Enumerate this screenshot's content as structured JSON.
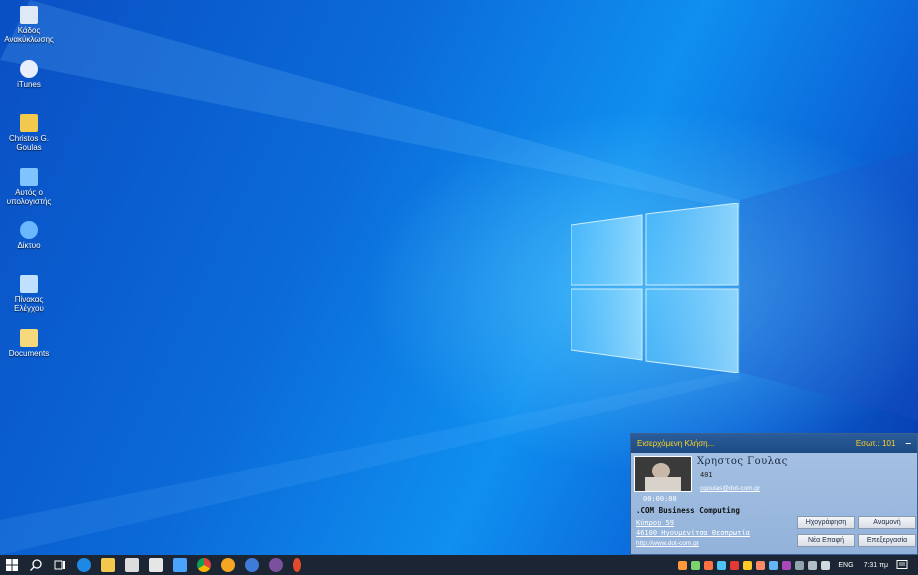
{
  "desktop": {
    "icons": [
      {
        "label": "Κάδος Ανακύκλωσης",
        "icon": "recycle-bin-icon",
        "color": "#dfe9f5"
      },
      {
        "label": "iTunes",
        "icon": "itunes-icon",
        "color": "#e9eefc"
      },
      {
        "label": "Christos G. Goulas",
        "icon": "user-folder-icon",
        "color": "#f2c94c"
      },
      {
        "label": "Αυτός ο υπολογιστής",
        "icon": "this-pc-icon",
        "color": "#7fc4ff"
      },
      {
        "label": "Δίκτυο",
        "icon": "network-icon",
        "color": "#6ab7ff"
      },
      {
        "label": "Πίνακας Ελέγχου",
        "icon": "control-panel-icon",
        "color": "#bfe0ff"
      },
      {
        "label": "Documents",
        "icon": "documents-icon",
        "color": "#f5d97a"
      }
    ]
  },
  "popup": {
    "title": "Εισερχόμενη Κλήση...",
    "extension_label": "Εσωτ.: 101",
    "minimize": "–",
    "caller_name": "Χρηστος Γουλας",
    "caller_ext": "401",
    "email": "cgoulas@dot-com.gr",
    "timer": "00:00:00",
    "company": ".COM Business Computing",
    "address_line1": "Κύπρου 59",
    "address_line2": "46100 Ηγουμενίτσα Θεσπρωτία",
    "website": "http://www.dot-com.gr",
    "buttons": {
      "record": "Ηχογράφηση",
      "hold": "Αναμονή",
      "new_contact": "Νέα Επαφή",
      "edit": "Επεξεργασία"
    }
  },
  "taskbar": {
    "language": "ENG",
    "clock": "7:31 πμ",
    "pinned": [
      "start-icon",
      "search-icon",
      "task-view-icon",
      "edge-icon",
      "file-explorer-icon",
      "store-icon",
      "mail-icon",
      "remote-desktop-icon",
      "chrome-icon",
      "firefox-icon",
      "app-icon",
      "viber-icon",
      "app2-icon"
    ],
    "tray": [
      "tray-app-1-icon",
      "tray-app-2-icon",
      "tray-app-3-icon",
      "tray-app-4-icon",
      "tray-app-5-icon",
      "tray-app-6-icon",
      "tray-app-7-icon",
      "tray-app-8-icon",
      "tray-app-9-icon",
      "tray-app-10-icon",
      "tray-network-icon",
      "tray-volume-icon"
    ]
  }
}
